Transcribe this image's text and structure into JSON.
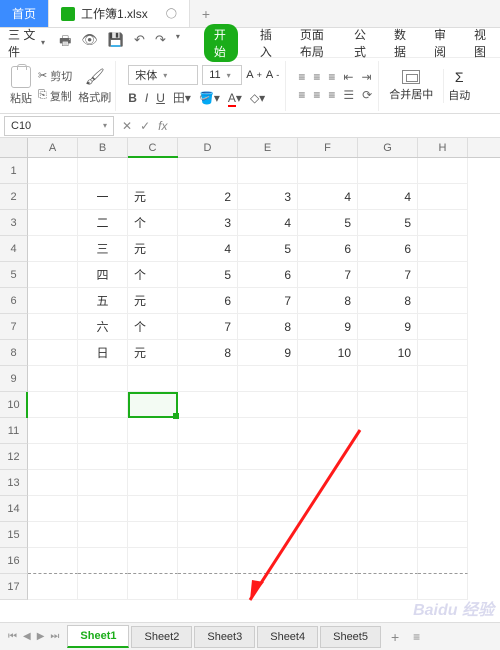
{
  "titlebar": {
    "home_tab": "首页",
    "doc_tab": "工作簿1.xlsx",
    "add": "+"
  },
  "menu": {
    "file": "三 文件",
    "qat": [
      "🖶",
      "⎌",
      "⎌",
      "↶",
      "↷"
    ],
    "tabs": {
      "start": "开始",
      "insert": "插入",
      "layout": "页面布局",
      "formula": "公式",
      "data": "数据",
      "review": "审阅",
      "view": "视图"
    }
  },
  "ribbon": {
    "paste": "粘贴",
    "cut": "剪切",
    "copy": "复制",
    "format_painter": "格式刷",
    "font_name": "宋体",
    "font_size": "11",
    "merge": "合并居中",
    "auto": "自动"
  },
  "namebox": "C10",
  "columns": [
    "A",
    "B",
    "C",
    "D",
    "E",
    "F",
    "G",
    "H"
  ],
  "rows": [
    "1",
    "2",
    "3",
    "4",
    "5",
    "6",
    "7",
    "8",
    "9",
    "10",
    "11",
    "12",
    "13",
    "14",
    "15",
    "16",
    "17"
  ],
  "cells": {
    "r2": {
      "B": "一",
      "C": "元",
      "D": "2",
      "E": "3",
      "F": "4",
      "G": "4"
    },
    "r3": {
      "B": "二",
      "C": "个",
      "D": "3",
      "E": "4",
      "F": "5",
      "G": "5"
    },
    "r4": {
      "B": "三",
      "C": "元",
      "D": "4",
      "E": "5",
      "F": "6",
      "G": "6"
    },
    "r5": {
      "B": "四",
      "C": "个",
      "D": "5",
      "E": "6",
      "F": "7",
      "G": "7"
    },
    "r6": {
      "B": "五",
      "C": "元",
      "D": "6",
      "E": "7",
      "F": "8",
      "G": "8"
    },
    "r7": {
      "B": "六",
      "C": "个",
      "D": "7",
      "E": "8",
      "F": "9",
      "G": "9"
    },
    "r8": {
      "B": "日",
      "C": "元",
      "D": "8",
      "E": "9",
      "F": "10",
      "G": "10"
    }
  },
  "sheets": [
    "Sheet1",
    "Sheet2",
    "Sheet3",
    "Sheet4",
    "Sheet5"
  ],
  "active_sheet": 0,
  "watermark": "Baidu 经验"
}
